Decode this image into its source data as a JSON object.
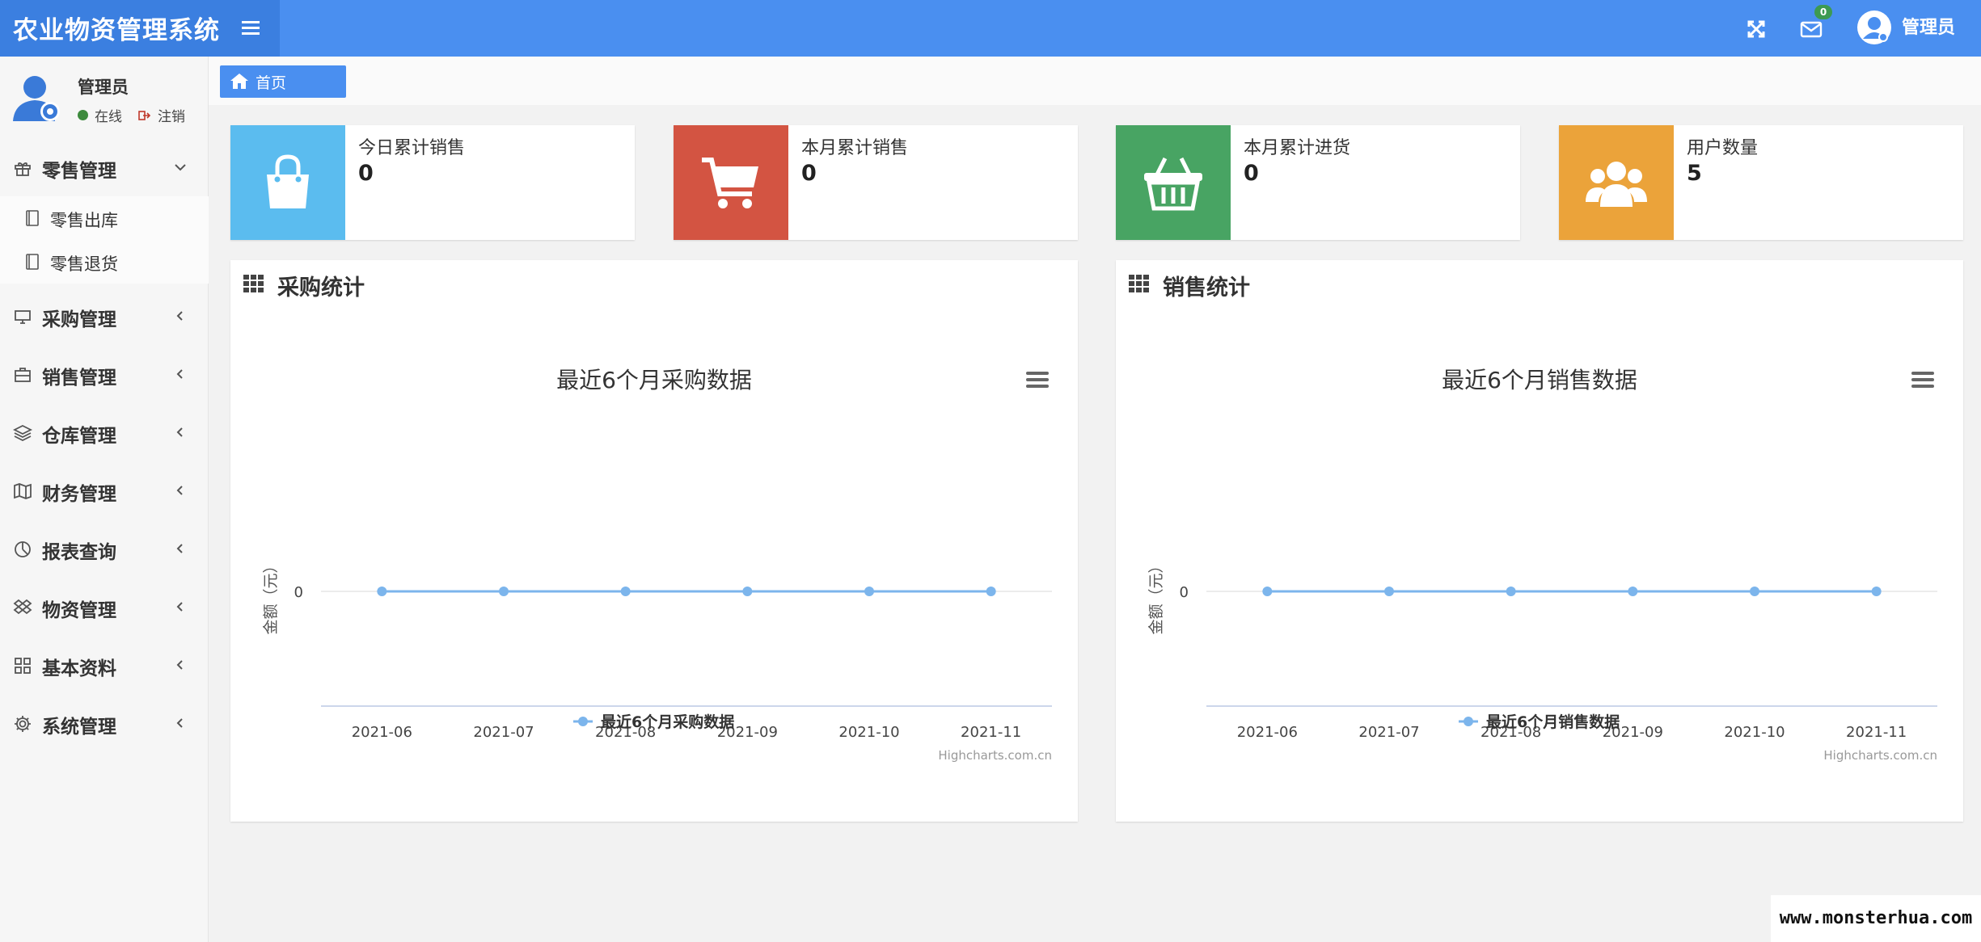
{
  "app": {
    "title": "农业物资管理系统"
  },
  "header": {
    "message_count": "0",
    "user_name": "管理员",
    "icons": [
      "expand-icon",
      "envelope-icon",
      "user-icon"
    ]
  },
  "sidebar": {
    "user_name": "管理员",
    "status_online": "在线",
    "logout": "注销",
    "items": [
      {
        "label": "零售管理",
        "icon": "gift-icon",
        "expanded": true,
        "children": [
          {
            "label": "零售出库",
            "icon": "book-icon"
          },
          {
            "label": "零售退货",
            "icon": "book-icon"
          }
        ]
      },
      {
        "label": "采购管理",
        "icon": "monitor-icon"
      },
      {
        "label": "销售管理",
        "icon": "briefcase-icon"
      },
      {
        "label": "仓库管理",
        "icon": "layers-icon"
      },
      {
        "label": "财务管理",
        "icon": "map-icon"
      },
      {
        "label": "报表查询",
        "icon": "chart-pie-icon"
      },
      {
        "label": "物资管理",
        "icon": "dropbox-icon"
      },
      {
        "label": "基本资料",
        "icon": "grid-icon"
      },
      {
        "label": "系统管理",
        "icon": "gear-icon"
      }
    ]
  },
  "breadcrumb": {
    "home": "首页"
  },
  "stats": [
    {
      "label": "今日累计销售",
      "value": "0",
      "color": "#5bbcef",
      "icon": "shopping-bag-icon"
    },
    {
      "label": "本月累计销售",
      "value": "0",
      "color": "#d35442",
      "icon": "shopping-cart-icon"
    },
    {
      "label": "本月累计进货",
      "value": "0",
      "color": "#48a463",
      "icon": "basket-icon"
    },
    {
      "label": "用户数量",
      "value": "5",
      "color": "#eba33a",
      "icon": "users-icon"
    }
  ],
  "panels": [
    {
      "title": "采购统计"
    },
    {
      "title": "销售统计"
    }
  ],
  "chart_data": [
    {
      "type": "line",
      "title": "最近6个月采购数据",
      "categories": [
        "2021-06",
        "2021-07",
        "2021-08",
        "2021-09",
        "2021-10",
        "2021-11"
      ],
      "series": [
        {
          "name": "最近6个月采购数据",
          "values": [
            0,
            0,
            0,
            0,
            0,
            0
          ],
          "color": "#7cb5ec"
        }
      ],
      "ylabel": "金额（元）",
      "yticks": [
        0
      ],
      "credits": "Highcharts.com.cn",
      "legend": "bottom-center"
    },
    {
      "type": "line",
      "title": "最近6个月销售数据",
      "categories": [
        "2021-06",
        "2021-07",
        "2021-08",
        "2021-09",
        "2021-10",
        "2021-11"
      ],
      "series": [
        {
          "name": "最近6个月销售数据",
          "values": [
            0,
            0,
            0,
            0,
            0,
            0
          ],
          "color": "#7cb5ec"
        }
      ],
      "ylabel": "金额（元）",
      "yticks": [
        0
      ],
      "credits": "Highcharts.com.cn",
      "legend": "bottom-center"
    }
  ],
  "watermark": "www.monsterhua.com"
}
